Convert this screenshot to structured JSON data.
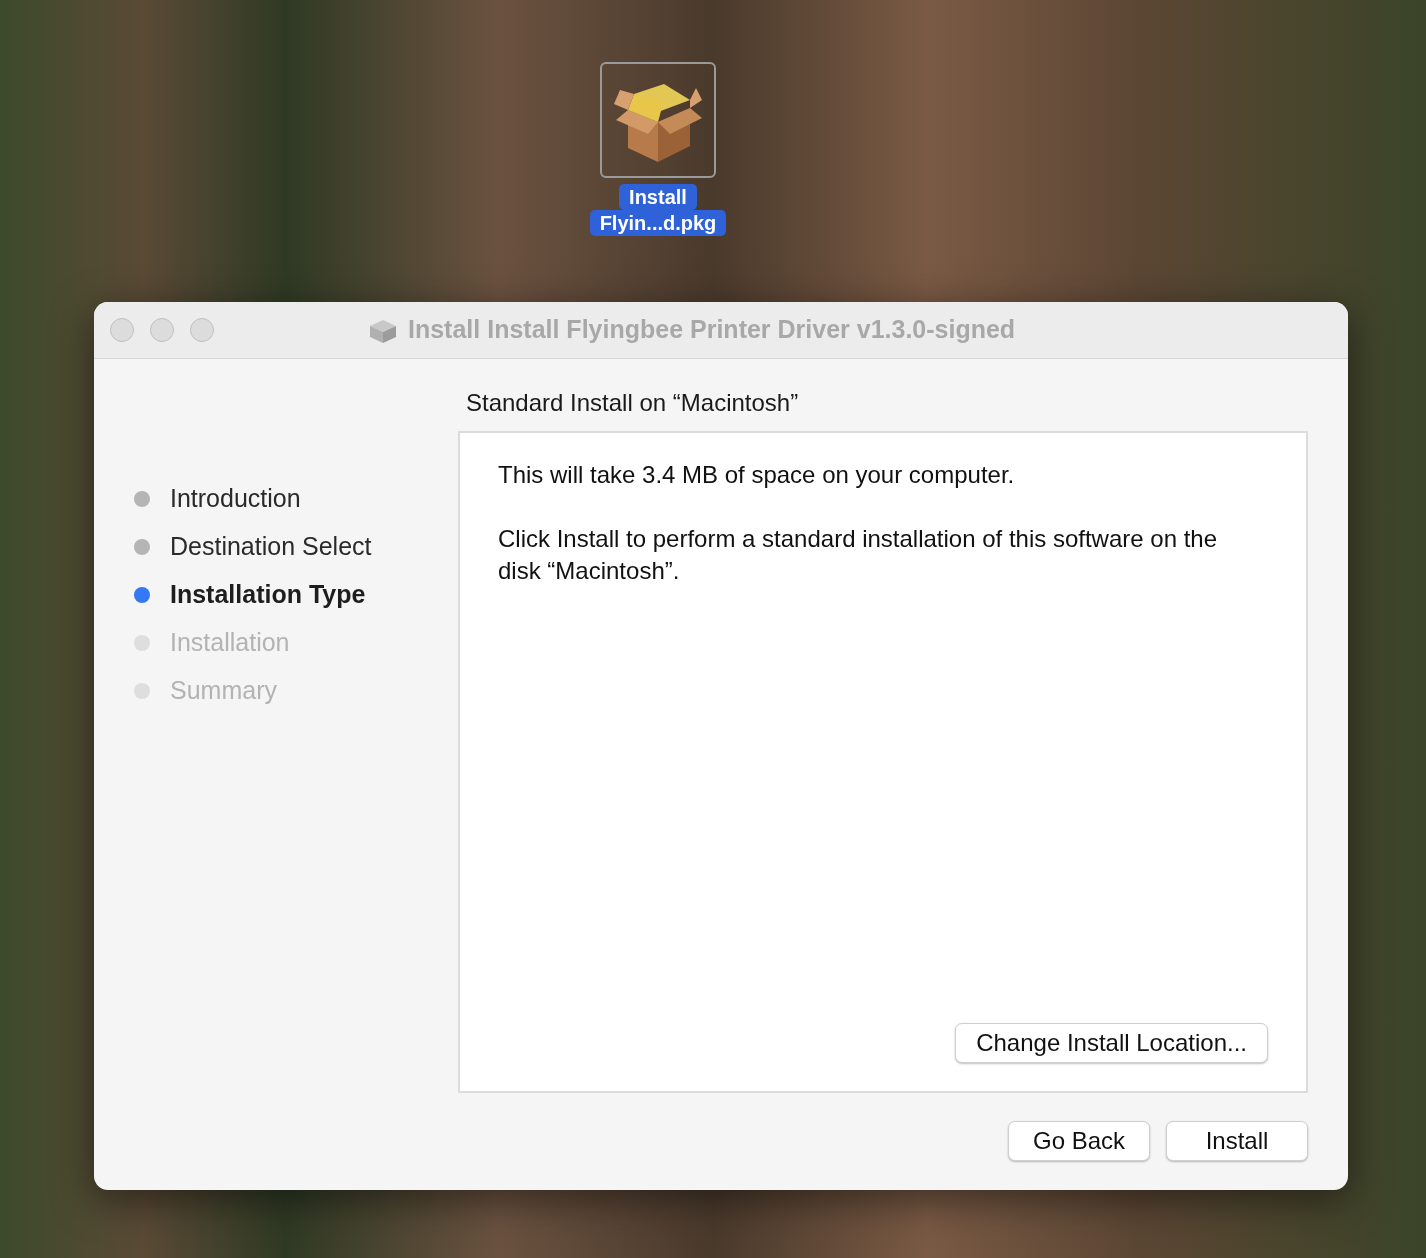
{
  "desktop": {
    "icon": {
      "label_lines": [
        "Install",
        "Flyin...d.pkg"
      ],
      "selected": true
    }
  },
  "window": {
    "title": "Install Install Flyingbee Printer Driver v1.3.0-signed",
    "steps": [
      {
        "label": "Introduction",
        "selected": false,
        "completed": true
      },
      {
        "label": "Destination Select",
        "selected": false,
        "completed": true
      },
      {
        "label": "Installation Type",
        "selected": true,
        "completed": false
      },
      {
        "label": "Installation",
        "selected": false,
        "completed": false
      },
      {
        "label": "Summary",
        "selected": false,
        "completed": false
      }
    ],
    "heading": "Standard Install on “Macintosh”",
    "paragraphs": [
      "This will take 3.4 MB of space on your computer.",
      "Click Install to perform a standard installation of this software on the disk “Macintosh”."
    ],
    "panel_button": "Change Install Location...",
    "buttons": [
      "Go Back",
      "Install"
    ]
  }
}
